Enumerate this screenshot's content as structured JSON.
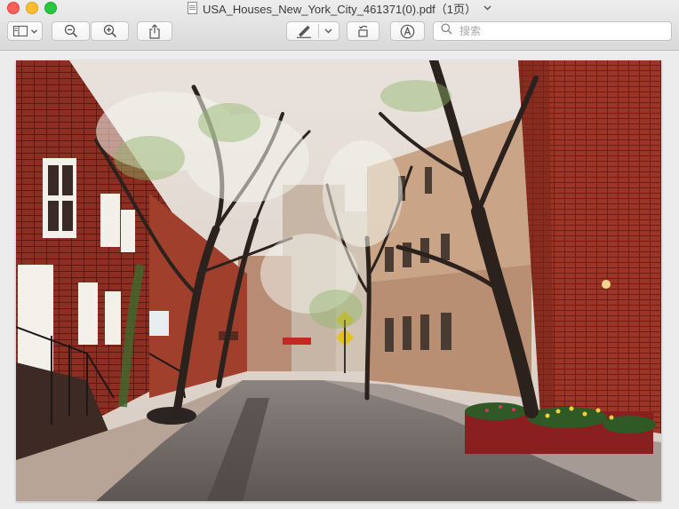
{
  "window": {
    "title": "USA_Houses_New_York_City_461371(0).pdf（1页）",
    "file_icon": "pdf-document-icon"
  },
  "toolbar": {
    "sidebar_button_icon": "sidebar-icon",
    "zoom_out_icon": "zoom-out-icon",
    "zoom_in_icon": "zoom-in-icon",
    "share_icon": "share-icon",
    "markup_icon": "pen-markup-icon",
    "rotate_icon": "rotate-icon",
    "annotate_icon": "annotate-circle-a-icon",
    "search_placeholder": "搜索"
  },
  "document": {
    "image": "photo of a tree-lined brick street"
  },
  "colors": {
    "close": "#fe5f57",
    "minimize": "#febc2e",
    "maximize": "#28c840"
  }
}
